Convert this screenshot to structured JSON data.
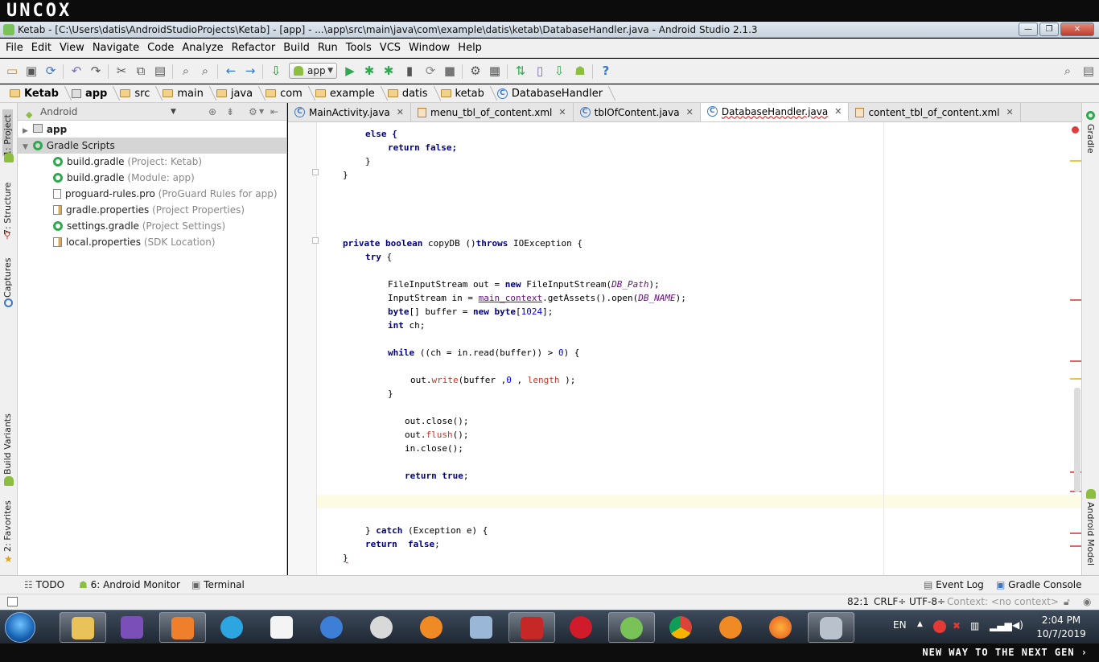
{
  "banner": {
    "logo": "UNCOX"
  },
  "window": {
    "title": "Ketab - [C:\\Users\\datis\\AndroidStudioProjects\\Ketab] - [app] - ...\\app\\src\\main\\java\\com\\example\\datis\\ketab\\DatabaseHandler.java - Android Studio 2.1.3",
    "controls": {
      "minimize": "—",
      "maximize": "❐",
      "close": "✕"
    }
  },
  "menu": [
    "File",
    "Edit",
    "View",
    "Navigate",
    "Code",
    "Analyze",
    "Refactor",
    "Build",
    "Run",
    "Tools",
    "VCS",
    "Window",
    "Help"
  ],
  "toolbar": {
    "run_config": "app",
    "icons": [
      "open-icon",
      "save-icon",
      "sync-icon",
      "undo-icon",
      "redo-icon",
      "cut-icon",
      "copy-icon",
      "paste-icon",
      "find-icon",
      "replace-icon",
      "back-icon",
      "forward-icon",
      "make-icon",
      "run-icon",
      "debug-icon",
      "attach-icon",
      "rerun-icon",
      "stop-icon",
      "project-structure-icon",
      "sdk-icon",
      "gradle-sync-icon",
      "avd-manager-icon",
      "sdk-manager-icon",
      "android-device-monitor-icon",
      "help-icon",
      "search-everywhere-icon"
    ]
  },
  "breadcrumbs": [
    "Ketab",
    "app",
    "src",
    "main",
    "java",
    "com",
    "example",
    "datis",
    "ketab",
    "DatabaseHandler"
  ],
  "left_tool_windows": [
    "1: Project",
    "7: Structure",
    "Captures",
    "Build Variants",
    "2: Favorites"
  ],
  "right_tool_windows": [
    "Gradle",
    "Android Model"
  ],
  "project": {
    "view_mode": "Android",
    "tree": [
      {
        "label": "app",
        "sub": "",
        "level": 0,
        "expanded": false
      },
      {
        "label": "Gradle Scripts",
        "sub": "",
        "level": 0,
        "expanded": true
      },
      {
        "label": "build.gradle",
        "sub": "(Project: Ketab)",
        "level": 1
      },
      {
        "label": "build.gradle",
        "sub": "(Module: app)",
        "level": 1
      },
      {
        "label": "proguard-rules.pro",
        "sub": "(ProGuard Rules for app)",
        "level": 1
      },
      {
        "label": "gradle.properties",
        "sub": "(Project Properties)",
        "level": 1
      },
      {
        "label": "settings.gradle",
        "sub": "(Project Settings)",
        "level": 1
      },
      {
        "label": "local.properties",
        "sub": "(SDK Location)",
        "level": 1
      }
    ]
  },
  "editor_tabs": [
    {
      "label": "MainActivity.java",
      "type": "class",
      "active": false
    },
    {
      "label": "menu_tbl_of_content.xml",
      "type": "xml",
      "active": false
    },
    {
      "label": "tblOfContent.java",
      "type": "class",
      "active": false
    },
    {
      "label": "DatabaseHandler.java",
      "type": "class",
      "active": true
    },
    {
      "label": "content_tbl_of_content.xml",
      "type": "xml",
      "active": false
    }
  ],
  "code": {
    "l1": "else {",
    "l2": "return false;",
    "l3": "}",
    "l4": "}",
    "l5a": "private boolean",
    "l5b": " copyDB ()",
    "l5c": "throws",
    "l5d": " IOException {",
    "l6": "try",
    "l6b": " {",
    "l7a": "FileInputStream out = ",
    "l7b": "new",
    "l7c": " FileInputStream(",
    "l7d": "DB_Path",
    "l7e": ");",
    "l8a": "InputStream in = ",
    "l8b": "main_context",
    "l8c": ".getAssets().open(",
    "l8d": "DB_NAME",
    "l8e": ");",
    "l9a": "byte",
    "l9b": "[] buffer = ",
    "l9c": "new",
    "l9d": " ",
    "l9e": "byte",
    "l9f": "[",
    "l9g": "1024",
    "l9h": "];",
    "l10a": "int",
    "l10b": " ch;",
    "l11a": "while",
    "l11b": " ((ch = in.read(buffer)) > ",
    "l11c": "0",
    "l11d": ") {",
    "l12a": "out.",
    "l12b": "write",
    "l12c": "(buffer ,",
    "l12d": "0",
    "l12e": " , ",
    "l12f": "length",
    "l12g": " );",
    "l13": "}",
    "l14": "out.close();",
    "l15a": "out.",
    "l15b": "flush",
    "l15c": "();",
    "l16": "in.close();",
    "l17a": "return",
    "l17b": " ",
    "l17c": "true",
    "l17d": ";",
    "l18a": "} ",
    "l18b": "catch",
    "l18c": " (Exception e) {",
    "l19a": "return",
    "l19b": "  ",
    "l19c": "false",
    "l19d": ";",
    "l20": "}"
  },
  "bottom_tool_windows": {
    "todo": "TODO",
    "android_monitor": "6: Android Monitor",
    "terminal": "Terminal",
    "event_log": "Event Log",
    "gradle_console": "Gradle Console"
  },
  "status": {
    "position": "82:1",
    "line_separator": "CRLF÷",
    "encoding": "UTF-8÷",
    "context": "Context: <no context>"
  },
  "taskbar": {
    "apps": [
      "explorer",
      "visual-studio",
      "media-player",
      "telegram",
      "document-app",
      "bird-app",
      "network-tool",
      "ccleaner",
      "remote-desktop",
      "psiphon",
      "opera",
      "android-studio",
      "chrome",
      "ccleaner-2",
      "firefox",
      "database-tool"
    ],
    "language": "EN",
    "time": "2:04 PM",
    "date": "10/7/2019"
  },
  "footer": {
    "slogan": "NEW WAY TO THE NEXT GEN ›"
  },
  "colors": {
    "keyword": "#000080",
    "field": "#660e7a",
    "number": "#0000ff",
    "method_call": "#c0392b",
    "caret_row": "#fdfbe3"
  }
}
